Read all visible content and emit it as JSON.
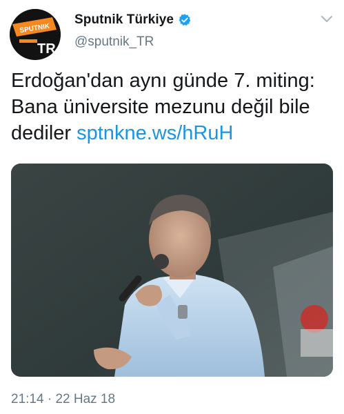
{
  "header": {
    "author_name": "Sputnik Türkiye",
    "handle": "@sputnik_TR",
    "verified": true,
    "avatar_text": {
      "brand": "SPUTNIK",
      "code": "TR"
    },
    "menu_icon": "chevron-down-icon"
  },
  "tweet": {
    "text_line1": "Erdoğan'dan aynı günde 7. miting:",
    "text_line2": "Bana üniversite mezunu değil bile",
    "text_line3_prefix": "dediler ",
    "link": "sptnkne.ws/hRuH",
    "media_description_icon": "photo"
  },
  "footer": {
    "time": "21:14",
    "separator": "·",
    "date": "22 Haz 18"
  },
  "colors": {
    "link": "#1b95e0",
    "secondary": "#657786",
    "primary_text": "#14171a",
    "avatar_bg": "#121212",
    "avatar_accent": "#f5891f",
    "verified": "#1da1f2"
  }
}
